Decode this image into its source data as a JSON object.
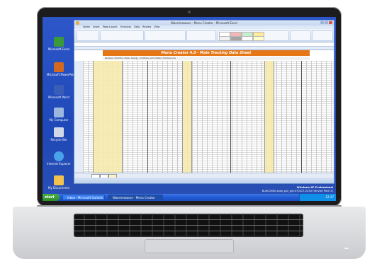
{
  "desktop": {
    "icons": [
      {
        "label": "Microsoft Excel",
        "icon": "excel-icon",
        "color": "#3a9a3a"
      },
      {
        "label": "Microsoft PowerPoint",
        "icon": "powerpoint-icon",
        "color": "#d2691e"
      },
      {
        "label": "Microsoft Word",
        "icon": "word-icon",
        "color": "#3b5dba"
      },
      {
        "label": "My Computer",
        "icon": "computer-icon",
        "color": "#9bb7e0"
      },
      {
        "label": "Recycle Bin",
        "icon": "recycle-bin-icon",
        "color": "#cfd8e6"
      },
      {
        "label": "Internet Explorer",
        "icon": "ie-icon",
        "color": "#4aa3ea"
      },
      {
        "label": "My Documents",
        "icon": "folder-icon",
        "color": "#f2c14e"
      }
    ],
    "watermark_line1": "Windows XP Professional",
    "watermark_line2": "Build 2600.xpsp_sp2_gdr.070227-2254 (Service Pack 2)"
  },
  "excel": {
    "window_title": "Waseimowave - Menu Creator - Microsoft Excel",
    "tabs": [
      "Home",
      "Insert",
      "Page Layout",
      "Formulas",
      "Data",
      "Review",
      "View"
    ],
    "banner_title": "Menu Creator 4.0 - Main Tracking Data Sheet",
    "sub_banner": "Recipes, Nutrition Data, Allergy, Additives and Dietary Preferences",
    "colors": {
      "banner": "#e67716",
      "yellow": "#f7eaaa",
      "green": "#6aa84f"
    }
  },
  "taskbar": {
    "start_label": "start",
    "items": [
      {
        "label": "Inbox - Microsoft Outlook",
        "active": false
      },
      {
        "label": "Waseimowave - Menu Creator",
        "active": true
      }
    ],
    "clock": "12:37"
  }
}
